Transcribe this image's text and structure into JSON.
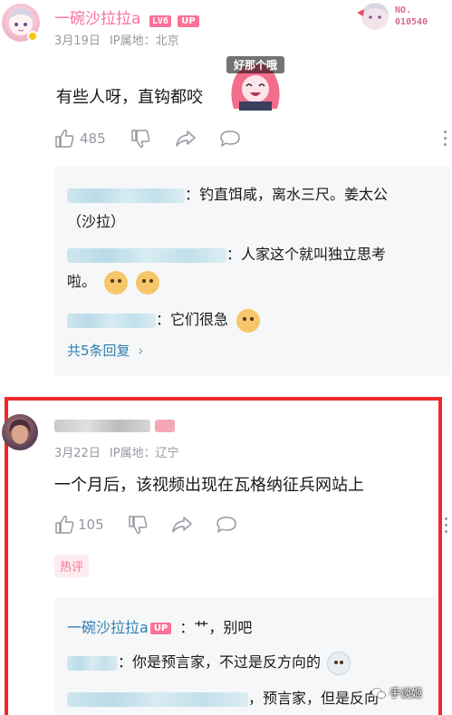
{
  "comment1": {
    "username": "一碗沙拉拉a",
    "level_badge": "LV6",
    "up_badge": "UP",
    "date": "3月19日",
    "ip": "IP属地：北京",
    "text": "有些人呀，直钩都咬",
    "sticker_text": "好那个哦",
    "likes": "485",
    "corner_badge": "NO.\n010540",
    "replies": [
      {
        "text": "：钓直饵咸，离水三尺。姜太公（沙拉）",
        "line1": "：钓直饵咸，离水三尺。姜太公",
        "line2": "（沙拉）"
      },
      {
        "line1": "：人家这个就叫独立思考",
        "line2": "啦。"
      },
      {
        "line1": "：它们很急"
      }
    ],
    "more_replies": "共5条回复",
    "more_arrow": "›"
  },
  "comment2": {
    "date": "3月22日",
    "ip": "IP属地：辽宁",
    "text": "一个月后，该视频出现在瓦格纳征兵网站上",
    "likes": "105",
    "hot_tag": "热评",
    "replies": [
      {
        "author": "一碗沙拉拉a",
        "author_badge": "UP",
        "text": "：艹，别吧"
      },
      {
        "text": "：你是预言家，不过是反方向的"
      },
      {
        "text": "，预言家，但是反向"
      }
    ]
  },
  "watermark": "手谈姬",
  "colors": {
    "accent": "#fb7299",
    "link": "#2f7fb0",
    "frame": "#f0282d",
    "muted": "#9499a0"
  }
}
